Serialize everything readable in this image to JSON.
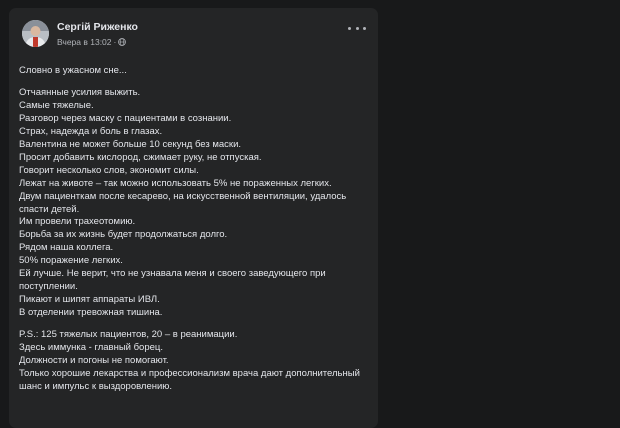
{
  "post": {
    "author": "Сергій Риженко",
    "timestamp": "Вчера в 13:02",
    "meta_separator": "·",
    "privacy_icon": "globe-icon",
    "more_icon": "more-options-icon",
    "paragraphs": [
      [
        "Словно в ужасном сне..."
      ],
      [
        "Отчаянные усилия выжить.",
        "Самые тяжелые.",
        "Разговор через маску с пациентами в сознании.",
        "Страх, надежда и боль в глазах.",
        "Валентина не может больше 10 секунд без маски.",
        "Просит добавить кислород, сжимает руку, не отпуская.",
        "Говорит несколько слов, экономит силы.",
        "Лежат на животе – так можно использовать 5% не пораженных легких.",
        "Двум пациенткам после кесарево, на искусственной вентиляции, удалось спасти детей.",
        "Им провели трахеотомию.",
        "Борьба за их жизнь будет продолжаться долго.",
        "Рядом наша коллега.",
        "50% поражение легких.",
        "Ей лучше. Не верит, что не узнавала меня и своего заведующего при поступлении.",
        "Пикают и шипят аппараты ИВЛ.",
        "В отделении тревожная тишина."
      ],
      [
        "P.S.: 125 тяжелых пациентов, 20 – в реанимации.",
        "Здесь иммунка - главный борец.",
        "Должности и погоны не помогают.",
        "Только хорошие лекарства и профессионализм врача дают дополнительный шанс и импульс к выздоровлению."
      ]
    ]
  },
  "colors": {
    "page_background": "#18191a",
    "card_background": "#242526",
    "primary_text": "#e4e6eb",
    "secondary_text": "#b0b3b8"
  }
}
